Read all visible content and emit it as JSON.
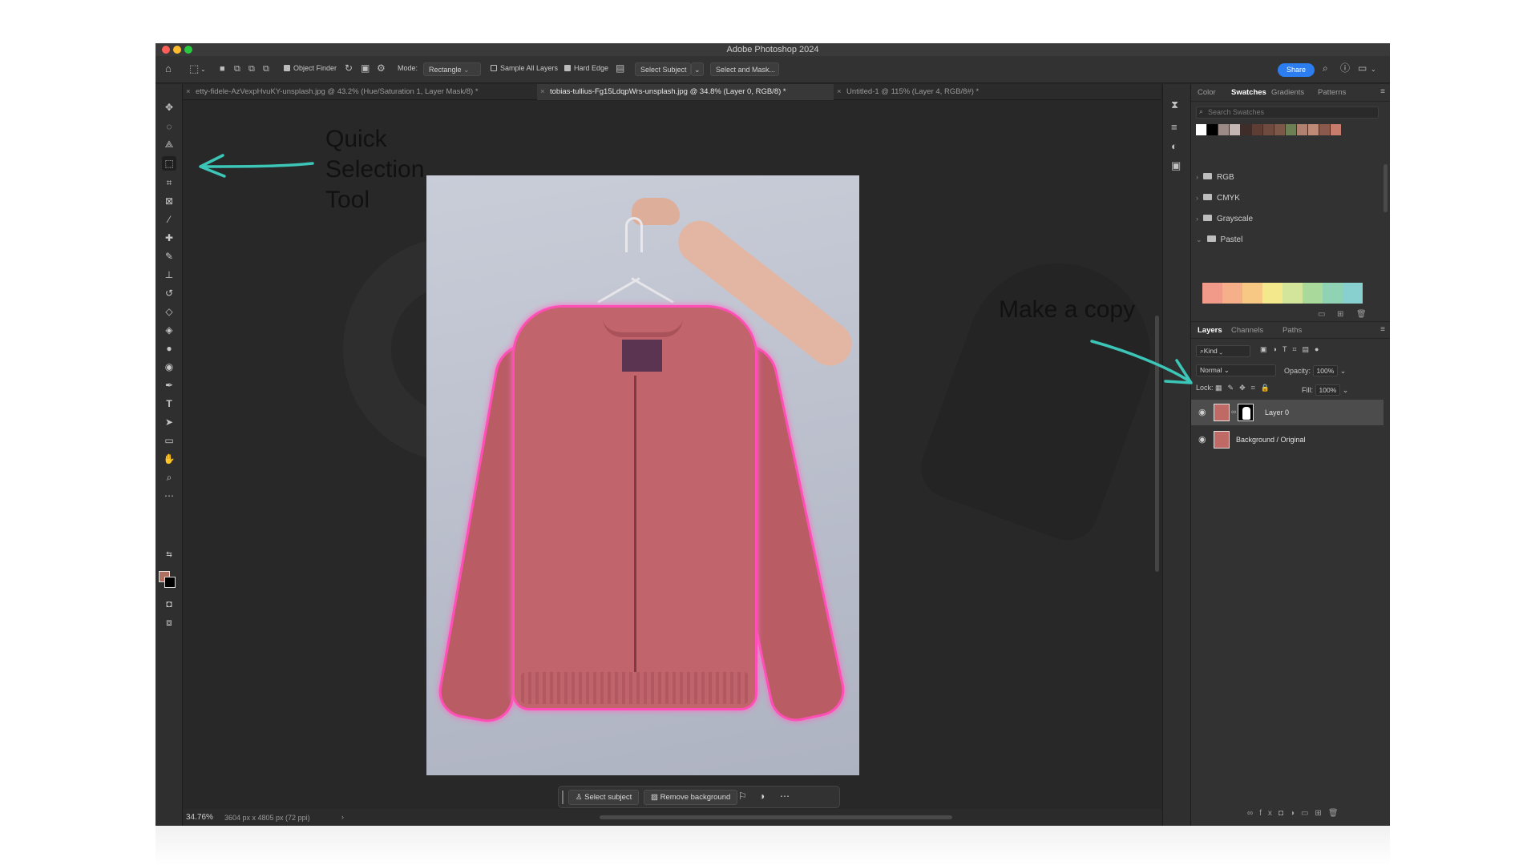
{
  "app": {
    "title": "Adobe Photoshop 2024"
  },
  "options_bar": {
    "object_finder": "Object Finder",
    "mode_label": "Mode:",
    "mode_value": "Rectangle",
    "sample_all_layers": "Sample All Layers",
    "hard_edge": "Hard Edge",
    "select_subject": "Select Subject",
    "select_and_mask": "Select and Mask...",
    "share": "Share"
  },
  "tabs": [
    {
      "label": "etty-fidele-AzVexpHvuKY-unsplash.jpg @ 43.2% (Hue/Saturation 1, Layer Mask/8) *",
      "active": false
    },
    {
      "label": "tobias-tullius-Fg15LdqpWrs-unsplash.jpg @ 34.8% (Layer 0, RGB/8) *",
      "active": true
    },
    {
      "label": "Untitled-1 @ 115% (Layer 4, RGB/8#) *",
      "active": false
    }
  ],
  "context_bar": {
    "select_subject": "Select subject",
    "remove_background": "Remove background"
  },
  "status": {
    "zoom": "34.76%",
    "dimensions": "3604 px x 4805 px (72 ppi)"
  },
  "swatches_panel": {
    "tabs": [
      "Color",
      "Swatches",
      "Gradients",
      "Patterns"
    ],
    "active_tab": "Swatches",
    "search_placeholder": "Search Swatches",
    "recent_colors": [
      "#ffffff",
      "#000000",
      "#9b8a86",
      "#c4b6b2",
      "#3f2d29",
      "#5e3d34",
      "#6f4a3f",
      "#7c5849",
      "#6d7f55",
      "#b08070",
      "#c08a78",
      "#8a5b4c",
      "#c77c6c"
    ],
    "folders": [
      "RGB",
      "CMYK",
      "Grayscale",
      "Pastel"
    ],
    "pastel_colors": [
      "#f29a8a",
      "#f5b08a",
      "#f7c884",
      "#f3e98c",
      "#d3e59a",
      "#a9da9c",
      "#8fd3b4",
      "#88d0d0"
    ]
  },
  "layers_panel": {
    "tabs": [
      "Layers",
      "Channels",
      "Paths"
    ],
    "active_tab": "Layers",
    "kind_label": "Kind",
    "blend_mode": "Normal",
    "opacity_label": "Opacity:",
    "opacity_value": "100%",
    "lock_label": "Lock:",
    "fill_label": "Fill:",
    "fill_value": "100%",
    "layers": [
      {
        "name": "Layer 0",
        "selected": true,
        "has_mask": true
      },
      {
        "name": "Background / Original",
        "selected": false,
        "has_mask": false
      }
    ]
  },
  "annotations": {
    "quick_selection_line1": "Quick",
    "quick_selection_line2": "Selection",
    "quick_selection_line3": "Tool",
    "make_copy": "Make a copy",
    "arrow_color": "#3cc6b8"
  },
  "accent_colors": {
    "selection_outline": "#ff4fb6",
    "share_button": "#2b7df0"
  }
}
